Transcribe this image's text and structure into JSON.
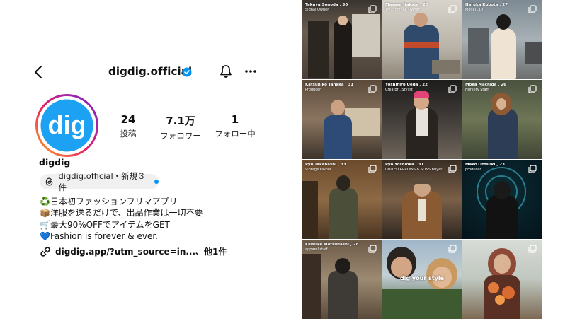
{
  "header": {
    "title": "digdig.official",
    "back_icon": "chevron-left-icon",
    "verified_icon": "verified-badge-icon",
    "bell_icon": "bell-icon",
    "more_icon": "ellipsis-icon"
  },
  "profile": {
    "avatar_text": "dig",
    "username": "digdig",
    "stats": [
      {
        "value": "24",
        "label": "投稿"
      },
      {
        "value": "7.1万",
        "label": "フォロワー"
      },
      {
        "value": "1",
        "label": "フォロー中"
      }
    ],
    "threads_badge": {
      "label": "digdig.official・新規３件"
    },
    "bio": [
      "♻️日本初ファッションフリマアプリ",
      "📦洋服を送るだけで、出品作業は一切不要",
      "🛒最大90%OFFでアイテムをGET",
      "💙Fashion is forever & ever."
    ],
    "link": "digdig.app/?utm_source=in...、他1件"
  },
  "grid": {
    "tiles": [
      {
        "name": "Takuya Sonoda , 30",
        "role": "Signal Owner"
      },
      {
        "name": "Masaya Nakata , 25",
        "role": "Trevor Frank Owner"
      },
      {
        "name": "Haruka Kubota , 27",
        "role": "Model , DJ"
      },
      {
        "name": "Katsuhiko Tanaka , 31",
        "role": "Producer"
      },
      {
        "name": "Yoshihiro Ueda , 22",
        "role": "Creator , Stylist"
      },
      {
        "name": "Moka Machida , 26",
        "role": "Nursery Staff"
      },
      {
        "name": "Ryo Takahashi , 33",
        "role": "Vintage Owner"
      },
      {
        "name": "Ryo Yoshioka , 31",
        "role": "UNITED ARROWS & SONS Buyer"
      },
      {
        "name": "Mako Ohtsuki , 23",
        "role": "producer"
      },
      {
        "name": "Keisuke Matsuhashi , 28",
        "role": "apparel staff"
      },
      {
        "name": "",
        "role": "",
        "center": "dig your style"
      },
      {
        "name": "",
        "role": ""
      }
    ]
  },
  "colors": {
    "accent": "#0095f6",
    "avatar_ring": [
      "#f9a825",
      "#e91e63",
      "#7b1fa2",
      "#1e88e5"
    ],
    "avatar_bg": "#1da1f2"
  }
}
